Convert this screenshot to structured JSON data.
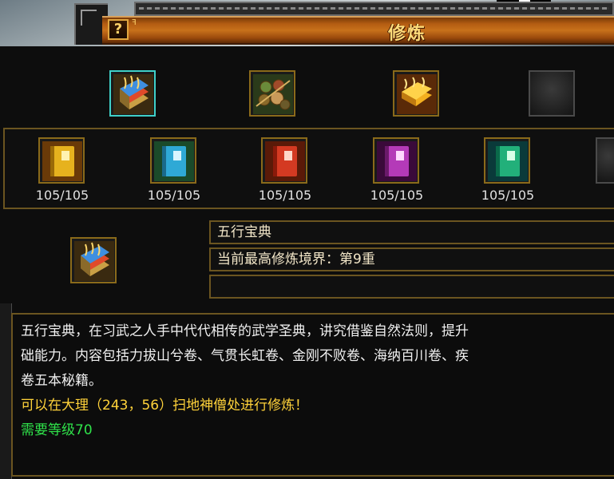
{
  "window": {
    "title": "修炼",
    "help_label": "?"
  },
  "top_row": [
    {
      "icon": "wuxing-baodian-book-icon",
      "selected": true
    },
    {
      "icon": "scroll-bundle-icon",
      "selected": false
    },
    {
      "icon": "golden-treasure-icon",
      "selected": false
    },
    {
      "icon": "empty-slot-icon",
      "selected": false
    }
  ],
  "skill_books": [
    {
      "icon": "yellow-book-icon",
      "color": "#e6b21e",
      "count": "105/105"
    },
    {
      "icon": "cyan-book-icon",
      "color": "#2fa9d6",
      "count": "105/105"
    },
    {
      "icon": "red-book-icon",
      "color": "#d43a22",
      "count": "105/105"
    },
    {
      "icon": "purple-book-icon",
      "color": "#b43ab8",
      "count": "105/105"
    },
    {
      "icon": "green-book-icon",
      "color": "#22b07a",
      "count": "105/105"
    }
  ],
  "detail": {
    "name": "五行宝典",
    "realm": "当前最高修炼境界：第9重",
    "extra": ""
  },
  "description": {
    "line1": "五行宝典，在习武之人手中代代相传的武学圣典，讲究借鉴自然法则，提升",
    "line2": "础能力。内容包括力拔山兮卷、气贯长虹卷、金刚不败卷、海纳百川卷、疾",
    "line3": "卷五本秘籍。",
    "location": "可以在大理（243，56）扫地神僧处进行修炼！",
    "requirement": "需要等级70"
  }
}
